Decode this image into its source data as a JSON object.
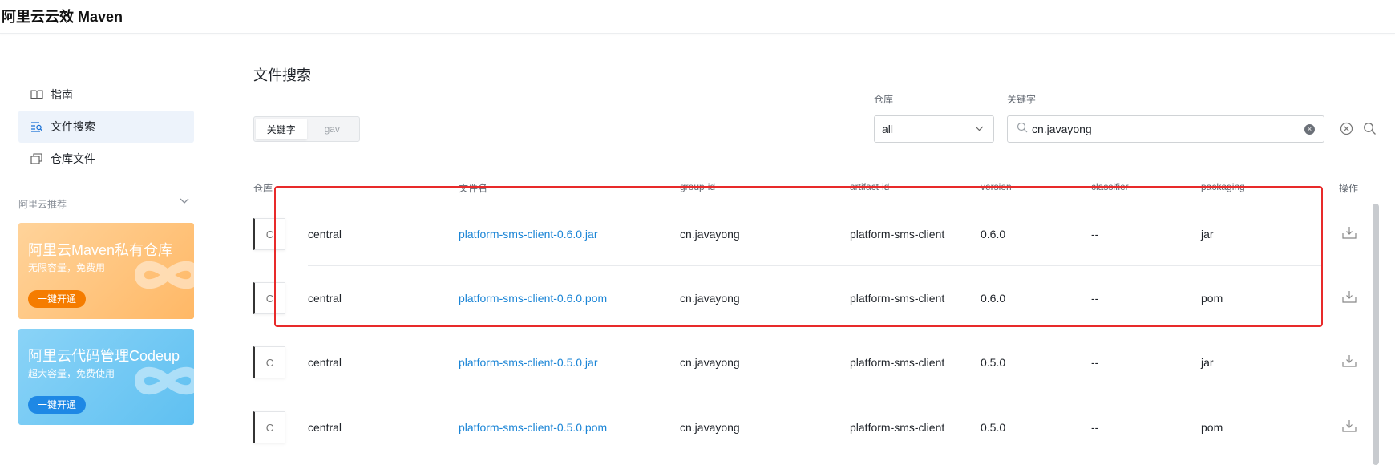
{
  "header": {
    "brand": "阿里云云效 Maven"
  },
  "sidebar": {
    "items": [
      {
        "label": "指南",
        "icon": "book-icon",
        "active": false
      },
      {
        "label": "文件搜索",
        "icon": "file-search-icon",
        "active": true
      },
      {
        "label": "仓库文件",
        "icon": "repository-files-icon",
        "active": false
      }
    ],
    "recommend_title": "阿里云推荐",
    "promos": [
      {
        "title": "阿里云Maven私有仓库",
        "subtitle": "无限容量，免费用",
        "button": "一键开通",
        "color": "#ffb866"
      },
      {
        "title": "阿里云代码管理Codeup",
        "subtitle": "超大容量，免费使用",
        "button": "一键开通",
        "color": "#5fc0f1"
      }
    ]
  },
  "main": {
    "title": "文件搜索",
    "mode_tabs": [
      "关键字",
      "gav"
    ],
    "active_mode": "关键字",
    "repo_label": "仓库",
    "repo_value": "all",
    "keyword_label": "关键字",
    "keyword_value": "cn.javayong",
    "table": {
      "headers": {
        "repo": "仓库",
        "filename": "文件名",
        "group_id": "group-id",
        "artifact_id": "artifact-id",
        "version": "version",
        "classifier": "classifier",
        "packaging": "packaging",
        "action": "操作"
      },
      "rows": [
        {
          "avatar": "C",
          "repo": "central",
          "filename": "platform-sms-client-0.6.0.jar",
          "group_id": "cn.javayong",
          "artifact_id": "platform-sms-client",
          "version": "0.6.0",
          "classifier": "--",
          "packaging": "jar"
        },
        {
          "avatar": "C",
          "repo": "central",
          "filename": "platform-sms-client-0.6.0.pom",
          "group_id": "cn.javayong",
          "artifact_id": "platform-sms-client",
          "version": "0.6.0",
          "classifier": "--",
          "packaging": "pom"
        },
        {
          "avatar": "C",
          "repo": "central",
          "filename": "platform-sms-client-0.5.0.jar",
          "group_id": "cn.javayong",
          "artifact_id": "platform-sms-client",
          "version": "0.5.0",
          "classifier": "--",
          "packaging": "jar"
        },
        {
          "avatar": "C",
          "repo": "central",
          "filename": "platform-sms-client-0.5.0.pom",
          "group_id": "cn.javayong",
          "artifact_id": "platform-sms-client",
          "version": "0.5.0",
          "classifier": "--",
          "packaging": "pom"
        }
      ]
    }
  },
  "colors": {
    "accent": "#1b85d6",
    "highlight": "#e82a2a"
  }
}
